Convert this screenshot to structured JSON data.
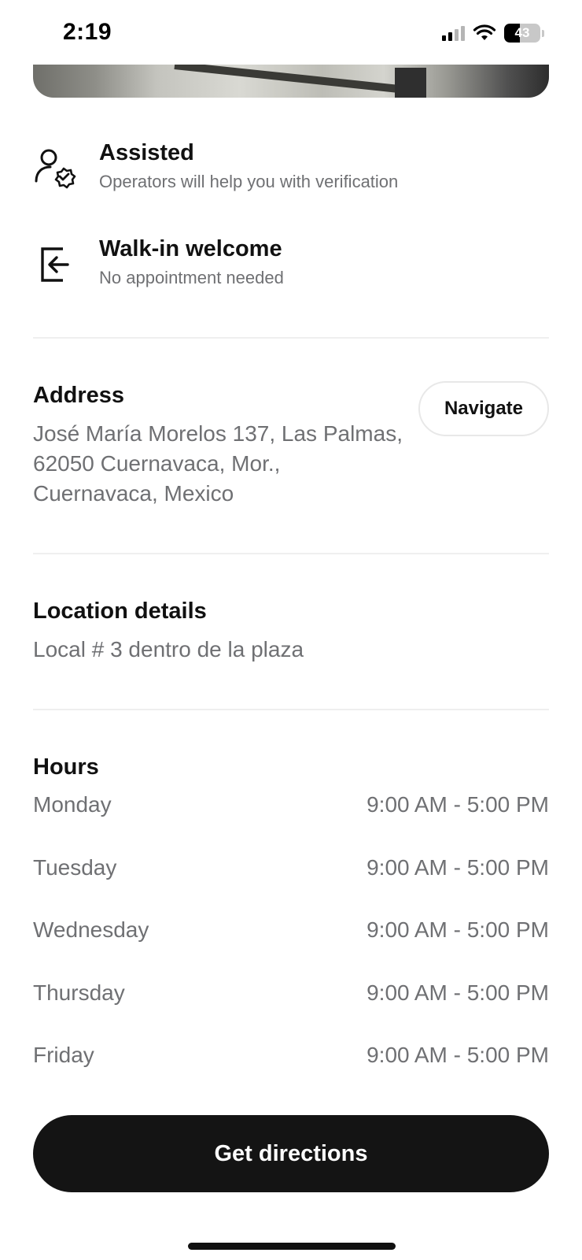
{
  "status_bar": {
    "time": "2:19",
    "battery_percent": "43",
    "battery_level": 0.43,
    "icons": [
      "cellular-signal-icon",
      "wifi-icon",
      "battery-icon"
    ]
  },
  "features": [
    {
      "icon": "verified-user-icon",
      "title": "Assisted",
      "subtitle": "Operators will help you with verification"
    },
    {
      "icon": "enter-door-icon",
      "title": "Walk-in welcome",
      "subtitle": "No appointment needed"
    }
  ],
  "address": {
    "heading": "Address",
    "lines": [
      "José María Morelos 137, Las Palmas,",
      "62050 Cuernavaca, Mor.,",
      "Cuernavaca, Mexico"
    ],
    "navigate_label": "Navigate"
  },
  "location_details": {
    "heading": "Location details",
    "text": "Local # 3 dentro de la plaza"
  },
  "hours": {
    "heading": "Hours",
    "rows": [
      {
        "day": "Monday",
        "time": "9:00 AM - 5:00 PM"
      },
      {
        "day": "Tuesday",
        "time": "9:00 AM - 5:00 PM"
      },
      {
        "day": "Wednesday",
        "time": "9:00 AM - 5:00 PM"
      },
      {
        "day": "Thursday",
        "time": "9:00 AM - 5:00 PM"
      },
      {
        "day": "Friday",
        "time": "9:00 AM - 5:00 PM"
      }
    ]
  },
  "cta": {
    "label": "Get directions"
  },
  "colors": {
    "primary_text": "#111111",
    "secondary_text": "#6f7073",
    "button_dark": "#141414",
    "divider": "#efefef"
  }
}
